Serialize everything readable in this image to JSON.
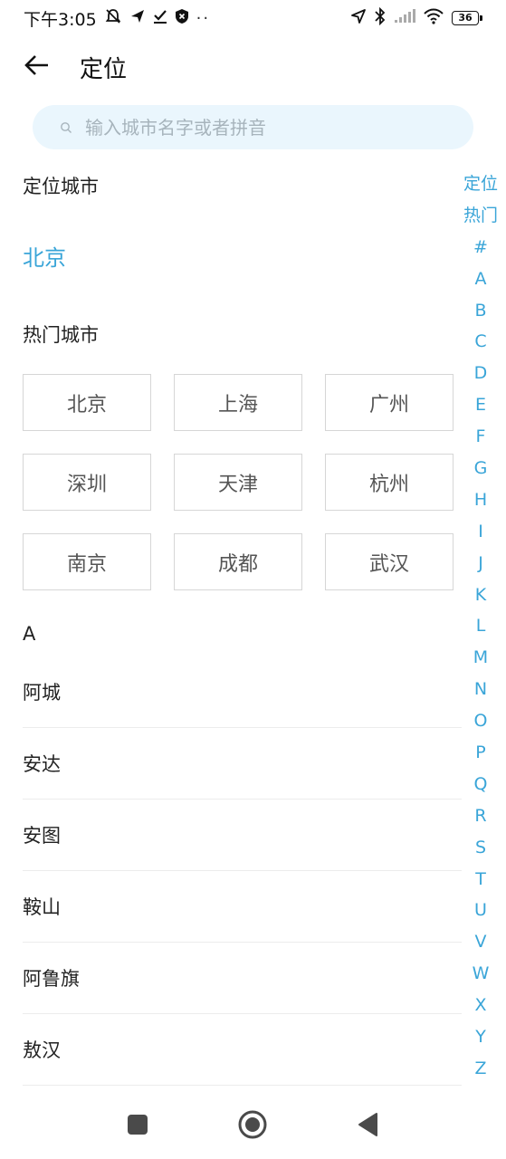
{
  "status_bar": {
    "time": "下午3:05",
    "battery": "36",
    "more": "··"
  },
  "header": {
    "title": "定位"
  },
  "search": {
    "placeholder": "输入城市名字或者拼音",
    "value": ""
  },
  "located": {
    "title": "定位城市",
    "city": "北京"
  },
  "hot": {
    "title": "热门城市",
    "cities": [
      "北京",
      "上海",
      "广州",
      "深圳",
      "天津",
      "杭州",
      "南京",
      "成都",
      "武汉"
    ]
  },
  "list": {
    "letter": "A",
    "cities": [
      "阿城",
      "安达",
      "安图",
      "鞍山",
      "阿鲁旗",
      "敖汉"
    ]
  },
  "index": [
    "定位",
    "热门",
    "#",
    "A",
    "B",
    "C",
    "D",
    "E",
    "F",
    "G",
    "H",
    "I",
    "J",
    "K",
    "L",
    "M",
    "N",
    "O",
    "P",
    "Q",
    "R",
    "S",
    "T",
    "U",
    "V",
    "W",
    "X",
    "Y",
    "Z"
  ],
  "colors": {
    "accent": "#3aa5d8",
    "search_bg": "#eaf6fd",
    "border": "#d6d6d6"
  },
  "icons": {
    "back": "arrow-left-icon",
    "search": "search-icon",
    "nav_recent": "square-icon",
    "nav_home": "circle-icon",
    "nav_back": "triangle-back-icon"
  }
}
